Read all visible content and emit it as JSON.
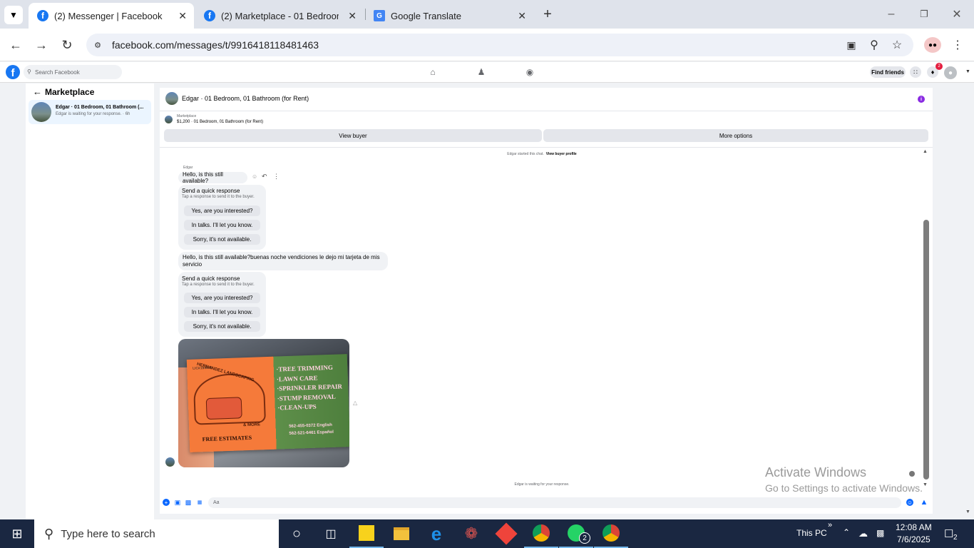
{
  "browser": {
    "tabs": [
      {
        "title": "(2) Messenger | Facebook",
        "active": true
      },
      {
        "title": "(2) Marketplace - 01 Bedroom, 0",
        "active": false
      },
      {
        "title": "Google Translate",
        "active": false
      }
    ],
    "url": "facebook.com/messages/t/9916418118481463"
  },
  "facebook": {
    "search_placeholder": "Search Facebook",
    "find_friends": "Find friends",
    "notification_count": "2"
  },
  "sidebar": {
    "title": "Marketplace",
    "conversation": {
      "title": "Edgar · 01 Bedroom, 01 Bathroom (...",
      "subtitle": "Edgar is waiting for your response. · 6h"
    }
  },
  "chat": {
    "title": "Edgar · 01 Bedroom, 01 Bathroom (for Rent)",
    "listing_source": "Marketplace",
    "listing_line": "$1,200 · 01 Bedroom, 01 Bathroom (for Rent)",
    "view_buyer": "View buyer",
    "more_options": "More options",
    "started_text": "Edgar started this chat.",
    "view_buyer_profile": "View buyer profile",
    "sender_name": "Edgar",
    "message1": "Hello, is this still available?",
    "message2": "Hello, is this still available?buenas noche vendiciones le dejo mi  tarjeta de mis servicio",
    "quick_title": "Send a quick response",
    "quick_sub": "Tap a response to send it to the buyer.",
    "quick_options": [
      "Yes, are you interested?",
      "In talks. I'll let you know.",
      "Sorry, it's not available."
    ],
    "waiting_text": "Edgar is waiting for your response.",
    "composer_placeholder": "Aa"
  },
  "card_image": {
    "license": "LIC#194608",
    "company": "HERNANDEZ LANDSCAPING",
    "and_more": "& MORE",
    "free_estimates": "FREE ESTIMATES",
    "services": [
      "·TREE TRIMMING",
      "·LAWN CARE",
      "·SPRINKLER REPAIR",
      "·STUMP REMOVAL",
      "·CLEAN-UPS"
    ],
    "phone1": "562-455-0372 English",
    "phone2": "562-521-6461 Español"
  },
  "watermark": {
    "line1": "Activate Windows",
    "line2": "Go to Settings to activate Windows."
  },
  "taskbar": {
    "search_placeholder": "Type here to search",
    "this_pc": "This PC",
    "time": "12:08 AM",
    "date": "7/6/2025",
    "notif_count": "2",
    "whatsapp_badge": "2"
  }
}
